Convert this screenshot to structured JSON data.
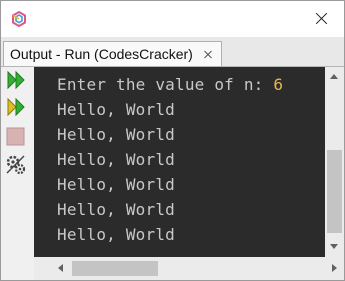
{
  "window": {
    "app_icon": "app-logo-icon",
    "close_icon": "close-icon"
  },
  "tab": {
    "label": "Output - Run (CodesCracker)",
    "close_icon": "tab-close-icon"
  },
  "toolbar": {
    "items": [
      {
        "icon": "rerun-icon",
        "color": "#2e9e2e"
      },
      {
        "icon": "rerun-with-options-icon",
        "color": "#2e9e2e"
      },
      {
        "icon": "stop-icon",
        "color": "#c89696"
      },
      {
        "icon": "settings-icon",
        "color": "#555555"
      }
    ]
  },
  "console": {
    "background": "#2b2b2b",
    "text_color": "#c8c8c8",
    "input_color": "#e8b54a",
    "prompt": "Enter the value of n: ",
    "input_value": "6",
    "lines": [
      "Hello, World",
      "Hello, World",
      "Hello, World",
      "Hello, World",
      "Hello, World",
      "Hello, World"
    ]
  }
}
